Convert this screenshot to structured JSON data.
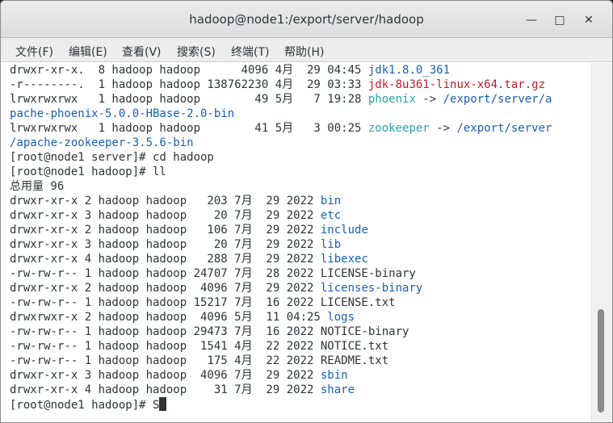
{
  "window": {
    "title": "hadoop@node1:/export/server/hadoop",
    "minimize_glyph": "—",
    "maximize_glyph": "□",
    "close_glyph": "✕"
  },
  "menu": [
    "文件(F)",
    "编辑(E)",
    "查看(V)",
    "搜索(S)",
    "终端(T)",
    "帮助(H)"
  ],
  "terminal": {
    "lines": [
      [
        {
          "t": "drwxr-xr-x.  8 hadoop hadoop      4096 4月  29 04:45 "
        },
        {
          "t": "jdk1.8.0_361",
          "c": "blue"
        }
      ],
      [
        {
          "t": "-r--------.  1 hadoop hadoop 138762230 4月  29 03:33 "
        },
        {
          "t": "jdk-8u361-linux-x64.tar.gz",
          "c": "red"
        }
      ],
      [
        {
          "t": "lrwxrwxrwx   1 hadoop hadoop        49 5月   7 19:28 "
        },
        {
          "t": "phoenix",
          "c": "cyan"
        },
        {
          "t": " -> "
        },
        {
          "t": "/export/server/a",
          "c": "blue"
        }
      ],
      [
        {
          "t": "pache-phoenix-5.0.0-HBase-2.0-bin",
          "c": "blue"
        }
      ],
      [
        {
          "t": "lrwxrwxrwx   1 hadoop hadoop        41 5月   3 00:25 "
        },
        {
          "t": "zookeeper",
          "c": "cyan"
        },
        {
          "t": " -> "
        },
        {
          "t": "/export/server",
          "c": "blue"
        }
      ],
      [
        {
          "t": "/apache-zookeeper-3.5.6-bin",
          "c": "blue"
        }
      ],
      [
        {
          "t": "[root@node1 server]# cd hadoop"
        }
      ],
      [
        {
          "t": "[root@node1 hadoop]# ll"
        }
      ],
      [
        {
          "t": "总用量 96"
        }
      ],
      [
        {
          "t": "drwxr-xr-x 2 hadoop hadoop   203 7月  29 2022 "
        },
        {
          "t": "bin",
          "c": "blue"
        }
      ],
      [
        {
          "t": "drwxr-xr-x 3 hadoop hadoop    20 7月  29 2022 "
        },
        {
          "t": "etc",
          "c": "blue"
        }
      ],
      [
        {
          "t": "drwxr-xr-x 2 hadoop hadoop   106 7月  29 2022 "
        },
        {
          "t": "include",
          "c": "blue"
        }
      ],
      [
        {
          "t": "drwxr-xr-x 3 hadoop hadoop    20 7月  29 2022 "
        },
        {
          "t": "lib",
          "c": "blue"
        }
      ],
      [
        {
          "t": "drwxr-xr-x 4 hadoop hadoop   288 7月  29 2022 "
        },
        {
          "t": "libexec",
          "c": "blue"
        }
      ],
      [
        {
          "t": "-rw-rw-r-- 1 hadoop hadoop 24707 7月  28 2022 LICENSE-binary"
        }
      ],
      [
        {
          "t": "drwxr-xr-x 2 hadoop hadoop  4096 7月  29 2022 "
        },
        {
          "t": "licenses-binary",
          "c": "blue"
        }
      ],
      [
        {
          "t": "-rw-rw-r-- 1 hadoop hadoop 15217 7月  16 2022 LICENSE.txt"
        }
      ],
      [
        {
          "t": "drwxrwxr-x 2 hadoop hadoop  4096 5月  11 04:25 "
        },
        {
          "t": "logs",
          "c": "blue"
        }
      ],
      [
        {
          "t": "-rw-rw-r-- 1 hadoop hadoop 29473 7月  16 2022 NOTICE-binary"
        }
      ],
      [
        {
          "t": "-rw-rw-r-- 1 hadoop hadoop  1541 4月  22 2022 NOTICE.txt"
        }
      ],
      [
        {
          "t": "-rw-rw-r-- 1 hadoop hadoop   175 4月  22 2022 README.txt"
        }
      ],
      [
        {
          "t": "drwxr-xr-x 3 hadoop hadoop  4096 7月  29 2022 "
        },
        {
          "t": "sbin",
          "c": "blue"
        }
      ],
      [
        {
          "t": "drwxr-xr-x 4 hadoop hadoop    31 7月  29 2022 "
        },
        {
          "t": "share",
          "c": "blue"
        }
      ],
      [
        {
          "t": "[root@node1 hadoop]# S"
        }
      ]
    ]
  }
}
